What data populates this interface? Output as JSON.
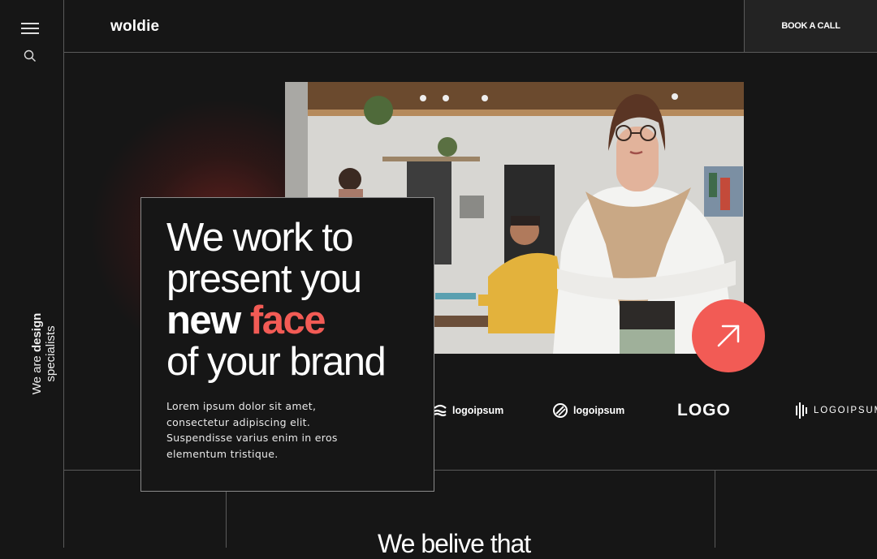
{
  "brand": {
    "name": "woldie"
  },
  "header": {
    "cta_label": "BOOK A CALL"
  },
  "rail": {
    "tagline_prefix": "We are",
    "tagline_bold": "design",
    "tagline_suffix": "specialists"
  },
  "hero": {
    "line1": "We work to",
    "line2": "present you",
    "line3_bold": "new",
    "line3_accent": "face",
    "line4": "of your brand",
    "body": "Lorem ipsum dolor sit amet, consectetur adipiscing elit. Suspendisse varius enim in eros elementum tristique."
  },
  "clients": [
    {
      "name": "logoipsum",
      "icon": "waves-icon"
    },
    {
      "name": "logoipsum",
      "icon": "circle-slash-icon"
    },
    {
      "name": "LOGO",
      "icon": "block-letter-icon"
    },
    {
      "name": "LOGOIPSUM",
      "icon": "soundbars-icon"
    }
  ],
  "next_section": {
    "heading": "We belive that"
  },
  "colors": {
    "accent": "#f25b55",
    "background": "#161616",
    "button_bg": "#232323"
  },
  "icons": {
    "menu": "hamburger-icon",
    "search": "search-icon",
    "arrow": "arrow-up-right-icon"
  }
}
